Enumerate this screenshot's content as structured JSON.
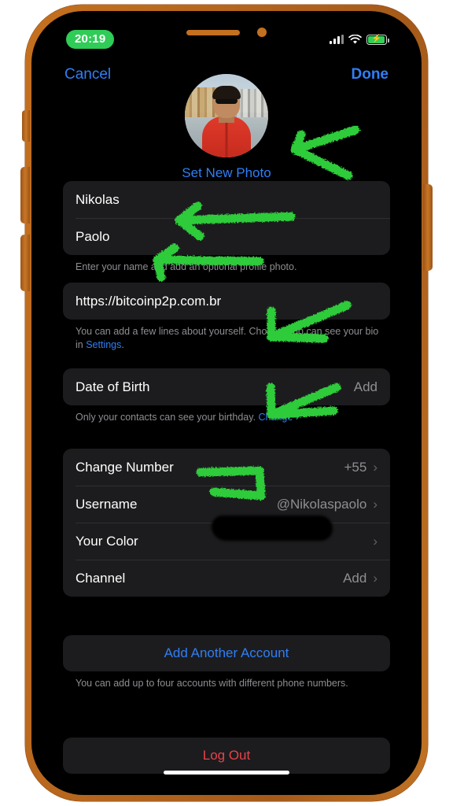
{
  "device": {
    "frame_color": "#b5651d",
    "screen_bg": "#000000"
  },
  "status_bar": {
    "time": "20:19",
    "time_pill_color": "#2fcc57",
    "signal_icon": "cellular-bars-icon",
    "wifi_icon": "wifi-icon",
    "battery_icon": "battery-charging-icon",
    "battery_color": "#31d158"
  },
  "navbar": {
    "cancel_label": "Cancel",
    "done_label": "Done",
    "accent": "#2f7ff5"
  },
  "profile": {
    "avatar_alt": "profile-photo",
    "set_photo_label": "Set New Photo"
  },
  "name_section": {
    "first_name": "Nikolas",
    "last_name": "Paolo",
    "hint": "Enter your name and add an optional profile photo."
  },
  "bio_section": {
    "bio": "https://bitcoinp2p.com.br",
    "hint_before": "You can add a few lines about yourself. Choose who can see your bio in ",
    "hint_link": "Settings",
    "hint_after": "."
  },
  "birth_section": {
    "label": "Date of Birth",
    "value": "Add",
    "hint_before": "Only your contacts can see your birthday. ",
    "hint_link": "Change",
    "hint_chevron": "›"
  },
  "account_rows": [
    {
      "label": "Change Number",
      "value": "+55",
      "redacted": true,
      "chevron": "›"
    },
    {
      "label": "Username",
      "value": "@Nikolaspaolo",
      "redacted": false,
      "chevron": "›"
    },
    {
      "label": "Your Color",
      "value": "",
      "redacted": false,
      "chevron": "›"
    },
    {
      "label": "Channel",
      "value": "Add",
      "redacted": false,
      "chevron": "›"
    }
  ],
  "add_account": {
    "label": "Add Another Account",
    "hint": "You can add up to four accounts with different phone numbers."
  },
  "logout": {
    "label": "Log Out",
    "color": "#e8424a"
  },
  "annotations": {
    "color": "#2ecc3a",
    "count": 5,
    "description": "hand-drawn green arrows pointing at photo, name fields, bio, date of birth and phone number"
  }
}
